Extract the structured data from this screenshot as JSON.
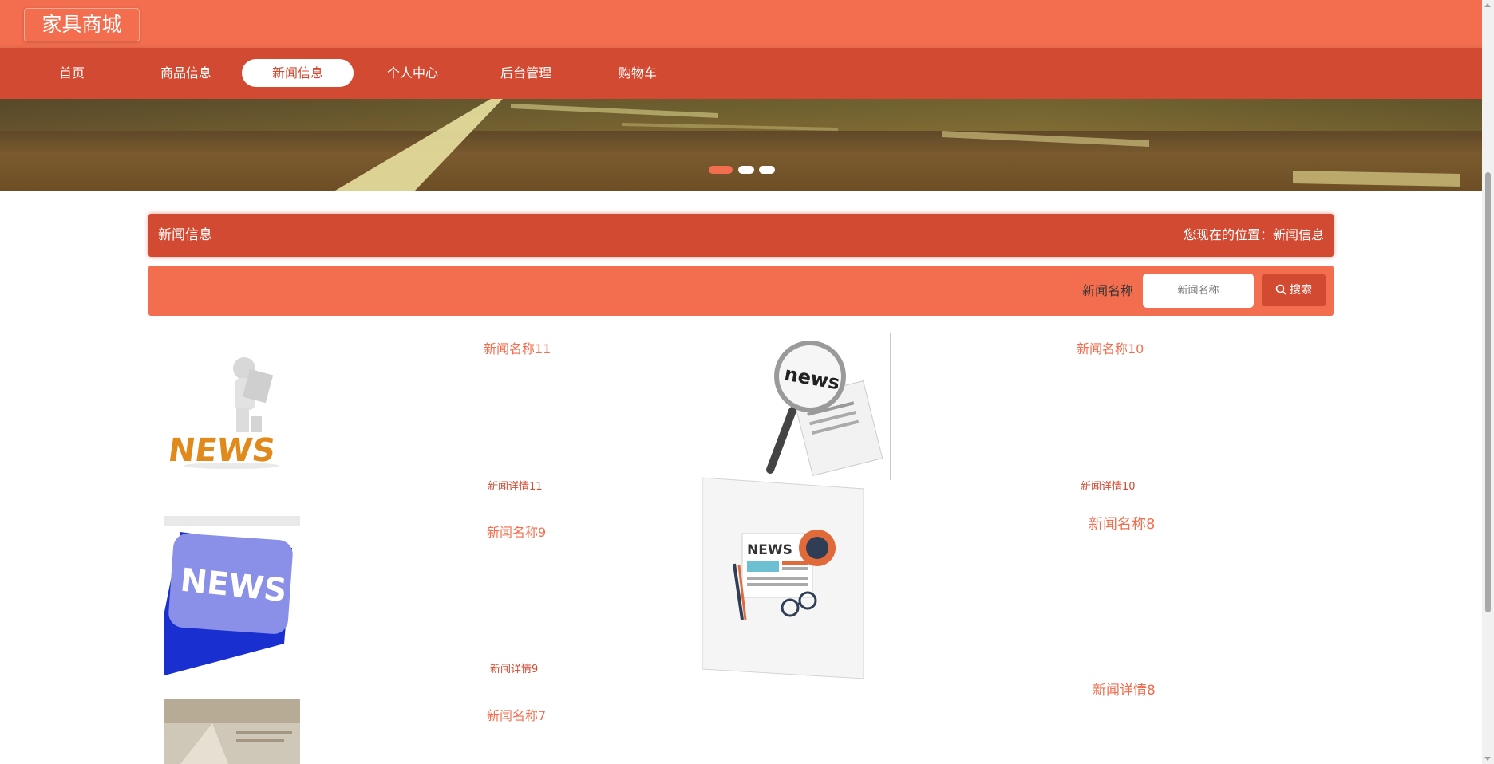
{
  "header": {
    "logo": "家具商城"
  },
  "nav": [
    {
      "label": "首页",
      "active": false
    },
    {
      "label": "商品信息",
      "active": false
    },
    {
      "label": "新闻信息",
      "active": true
    },
    {
      "label": "个人中心",
      "active": false
    },
    {
      "label": "后台管理",
      "active": false
    },
    {
      "label": "购物车",
      "active": false
    }
  ],
  "banner": {
    "slides": 3,
    "active_slide": 1
  },
  "section": {
    "title": "新闻信息",
    "location": "您现在的位置：新闻信息"
  },
  "search": {
    "label": "新闻名称",
    "placeholder": "新闻名称",
    "button": "搜索"
  },
  "news": [
    {
      "title": "新闻名称11",
      "detail": "新闻详情11"
    },
    {
      "title": "新闻名称10",
      "detail": "新闻详情10"
    },
    {
      "title": "新闻名称9",
      "detail": "新闻详情9"
    },
    {
      "title": "新闻名称8",
      "detail": "新闻详情8"
    },
    {
      "title": "新闻名称7"
    }
  ],
  "colors": {
    "primary": "#f26e4f",
    "dark": "#d24a31"
  }
}
